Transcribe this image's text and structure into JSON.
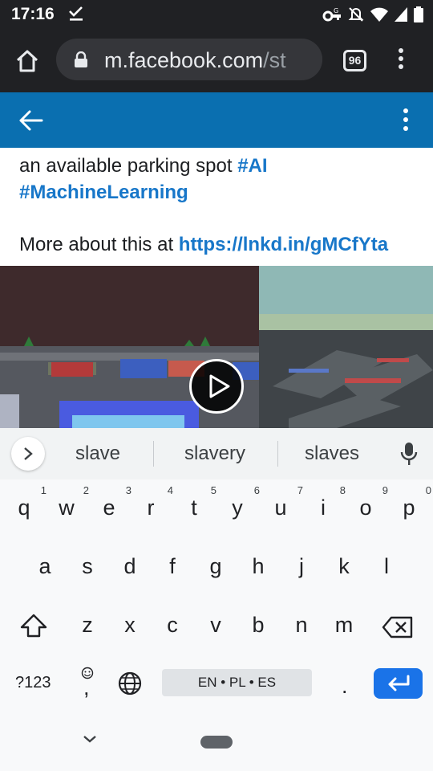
{
  "status_bar": {
    "time": "17:16"
  },
  "browser": {
    "url_main": "m.facebook.com",
    "url_rest": "/st",
    "tab_count": "96"
  },
  "post": {
    "line1_text": "an available parking spot ",
    "line1_tag": "#AI",
    "line2_tag": "#MachineLearning",
    "more_text": "More about this at ",
    "more_link": "https://lnkd.in/gMCfYta"
  },
  "suggestions": [
    "slave",
    "slavery",
    "slaves"
  ],
  "keyboard": {
    "row1": [
      {
        "key": "q",
        "hint": "1"
      },
      {
        "key": "w",
        "hint": "2"
      },
      {
        "key": "e",
        "hint": "3"
      },
      {
        "key": "r",
        "hint": "4"
      },
      {
        "key": "t",
        "hint": "5"
      },
      {
        "key": "y",
        "hint": "6"
      },
      {
        "key": "u",
        "hint": "7"
      },
      {
        "key": "i",
        "hint": "8"
      },
      {
        "key": "o",
        "hint": "9"
      },
      {
        "key": "p",
        "hint": "0"
      }
    ],
    "row2": [
      "a",
      "s",
      "d",
      "f",
      "g",
      "h",
      "j",
      "k",
      "l"
    ],
    "row3": [
      "z",
      "x",
      "c",
      "v",
      "b",
      "n",
      "m"
    ],
    "symbols_label": "?123",
    "comma_label": ",",
    "period_label": ".",
    "space_label": "EN • PL • ES"
  },
  "colors": {
    "app_bar": "#0a6fb0",
    "link": "#1877c9",
    "enter_key": "#1a73e8"
  }
}
